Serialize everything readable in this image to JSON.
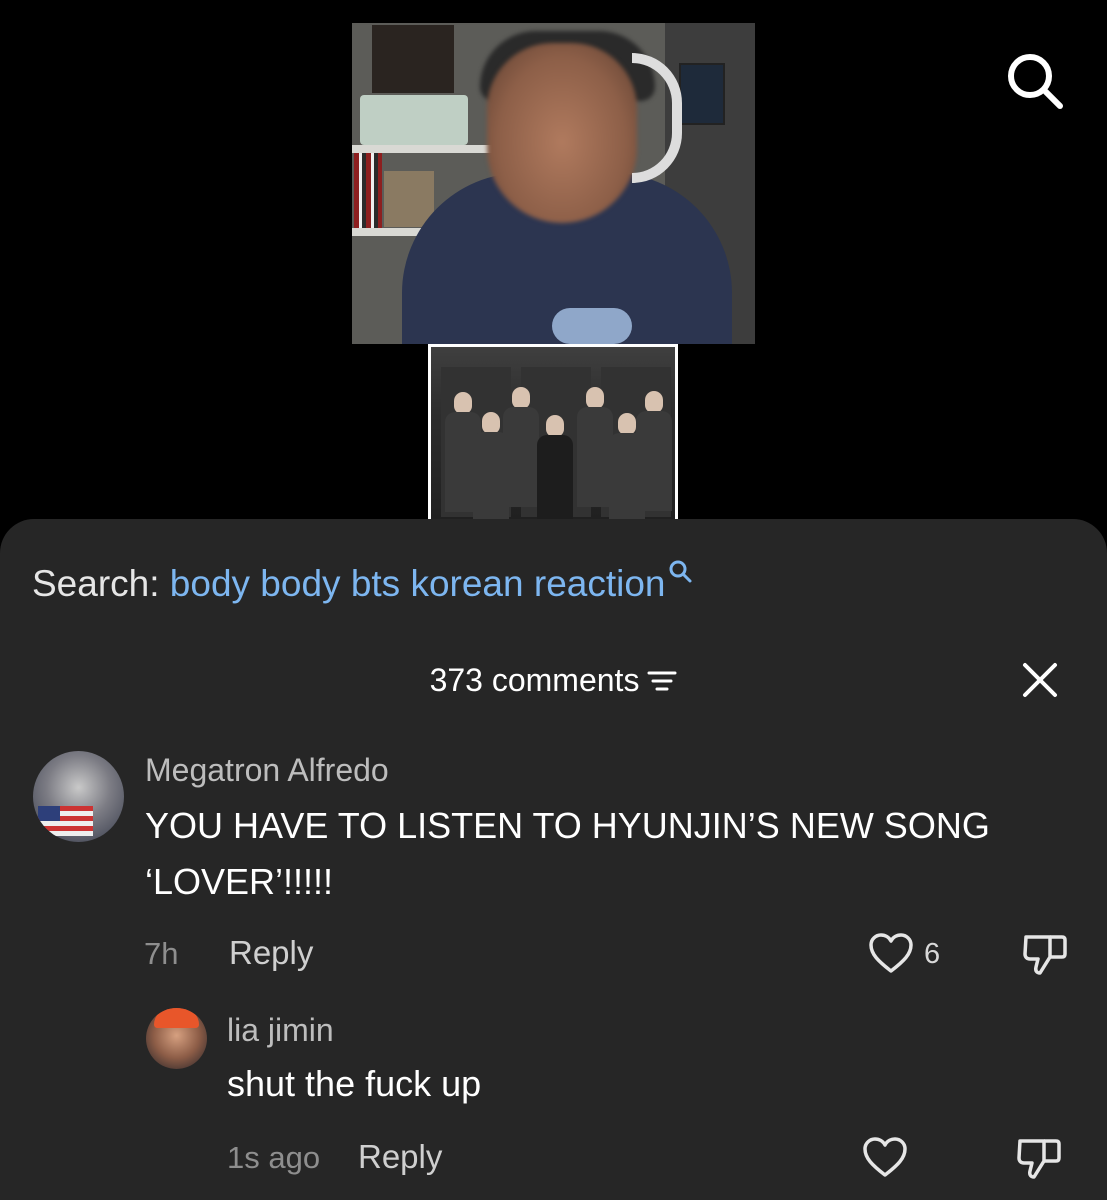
{
  "search": {
    "label": "Search:",
    "query": "body body bts korean reaction"
  },
  "comments_header": {
    "count_label": "373 comments"
  },
  "comments": [
    {
      "author": "Megatron Alfredo",
      "text": "YOU HAVE TO LISTEN TO HYUNJIN’S NEW SONG ‘LOVER’!!!!!",
      "time": "7h",
      "reply_label": "Reply",
      "likes": "6"
    },
    {
      "author": "lia jimin",
      "text": "shut the fuck up",
      "time": "1s ago",
      "reply_label": "Reply",
      "likes": ""
    }
  ],
  "colors": {
    "sheet_background": "#262626",
    "query_link": "#7db6f0",
    "muted_text": "#8e8e8e"
  },
  "icons": [
    "search-icon",
    "search-query-icon",
    "sort-icon",
    "close-icon",
    "heart-icon",
    "dislike-icon"
  ]
}
